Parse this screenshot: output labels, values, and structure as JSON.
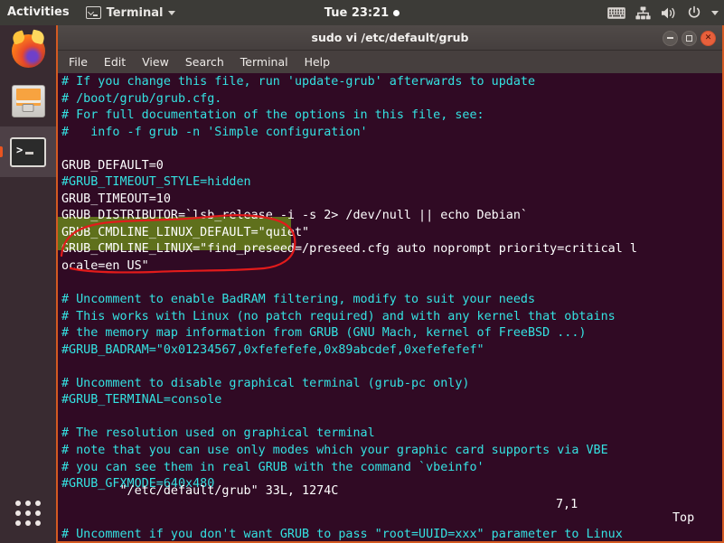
{
  "topbar": {
    "activities": "Activities",
    "app_name": "Terminal",
    "app_icon": "terminal-icon",
    "clock": "Tue 23:21",
    "icons": [
      "keyboard-icon",
      "network-icon",
      "volume-icon",
      "power-icon",
      "chevron-down-icon"
    ]
  },
  "dock": {
    "items": [
      {
        "name": "firefox",
        "label": "Firefox",
        "active": false
      },
      {
        "name": "files",
        "label": "Files",
        "active": false
      },
      {
        "name": "terminal",
        "label": "Terminal",
        "active": true
      }
    ],
    "show_apps_label": "Show Applications"
  },
  "window": {
    "title": "sudo vi /etc/default/grub",
    "controls": {
      "minimize": "minimize-button",
      "maximize": "maximize-button",
      "close": "close-button"
    },
    "menu": [
      "File",
      "Edit",
      "View",
      "Search",
      "Terminal",
      "Help"
    ]
  },
  "terminal": {
    "lines": [
      {
        "text": "# If you change this file, run 'update-grub' afterwards to update",
        "cls": "c-comment"
      },
      {
        "text": "# /boot/grub/grub.cfg.",
        "cls": "c-comment"
      },
      {
        "text": "# For full documentation of the options in this file, see:",
        "cls": "c-comment"
      },
      {
        "text": "#   info -f grub -n 'Simple configuration'",
        "cls": "c-comment"
      },
      {
        "text": "",
        "cls": "c-plain"
      },
      {
        "text": "GRUB_DEFAULT=0",
        "cls": "c-plain"
      },
      {
        "text": "#GRUB_TIMEOUT_STYLE=hidden",
        "cls": "c-comment"
      },
      {
        "text": "GRUB_TIMEOUT=10",
        "cls": "c-plain"
      },
      {
        "text": "GRUB_DISTRIBUTOR=`lsb_release -i -s 2> /dev/null || echo Debian`",
        "cls": "c-plain"
      },
      {
        "text": "GRUB_CMDLINE_LINUX_DEFAULT=\"quiet\"",
        "cls": "c-plain"
      },
      {
        "text": "GRUB_CMDLINE_LINUX=\"find_preseed=/preseed.cfg auto noprompt priority=critical l",
        "cls": "c-plain"
      },
      {
        "text": "ocale=en_US\"",
        "cls": "c-plain"
      },
      {
        "text": "",
        "cls": "c-plain"
      },
      {
        "text": "# Uncomment to enable BadRAM filtering, modify to suit your needs",
        "cls": "c-comment"
      },
      {
        "text": "# This works with Linux (no patch required) and with any kernel that obtains",
        "cls": "c-comment"
      },
      {
        "text": "# the memory map information from GRUB (GNU Mach, kernel of FreeBSD ...)",
        "cls": "c-comment"
      },
      {
        "text": "#GRUB_BADRAM=\"0x01234567,0xfefefefe,0x89abcdef,0xefefefef\"",
        "cls": "c-comment"
      },
      {
        "text": "",
        "cls": "c-plain"
      },
      {
        "text": "# Uncomment to disable graphical terminal (grub-pc only)",
        "cls": "c-comment"
      },
      {
        "text": "#GRUB_TERMINAL=console",
        "cls": "c-comment"
      },
      {
        "text": "",
        "cls": "c-plain"
      },
      {
        "text": "# The resolution used on graphical terminal",
        "cls": "c-comment"
      },
      {
        "text": "# note that you can use only modes which your graphic card supports via VBE",
        "cls": "c-comment"
      },
      {
        "text": "# you can see them in real GRUB with the command `vbeinfo'",
        "cls": "c-comment"
      },
      {
        "text": "#GRUB_GFXMODE=640x480",
        "cls": "c-comment"
      },
      {
        "text": "",
        "cls": "c-plain"
      },
      {
        "text": "",
        "cls": "c-plain"
      },
      {
        "text": "# Uncomment if you don't want GRUB to pass \"root=UUID=xxx\" parameter to Linux",
        "cls": "c-comment"
      }
    ],
    "status": {
      "file": "\"/etc/default/grub\" 33L, 1274C",
      "position": "7,1",
      "scroll": "Top"
    },
    "highlight": {
      "name": "green-highlight",
      "color": "#6c8a1a",
      "covers": [
        "#GRUB_TIMEOUT_STYLE=hidden",
        "GRUB_TIMEOUT=10"
      ]
    },
    "annotation": {
      "name": "red-circle-annotation",
      "color": "#e21b1b"
    }
  },
  "colors": {
    "terminal_bg": "#300a24",
    "comment": "#34e2e2",
    "text": "#ffffff",
    "window_border": "#d45a22",
    "accent": "#e95420",
    "topbar_bg": "#3c3b37",
    "dock_bg": "#392b31"
  }
}
